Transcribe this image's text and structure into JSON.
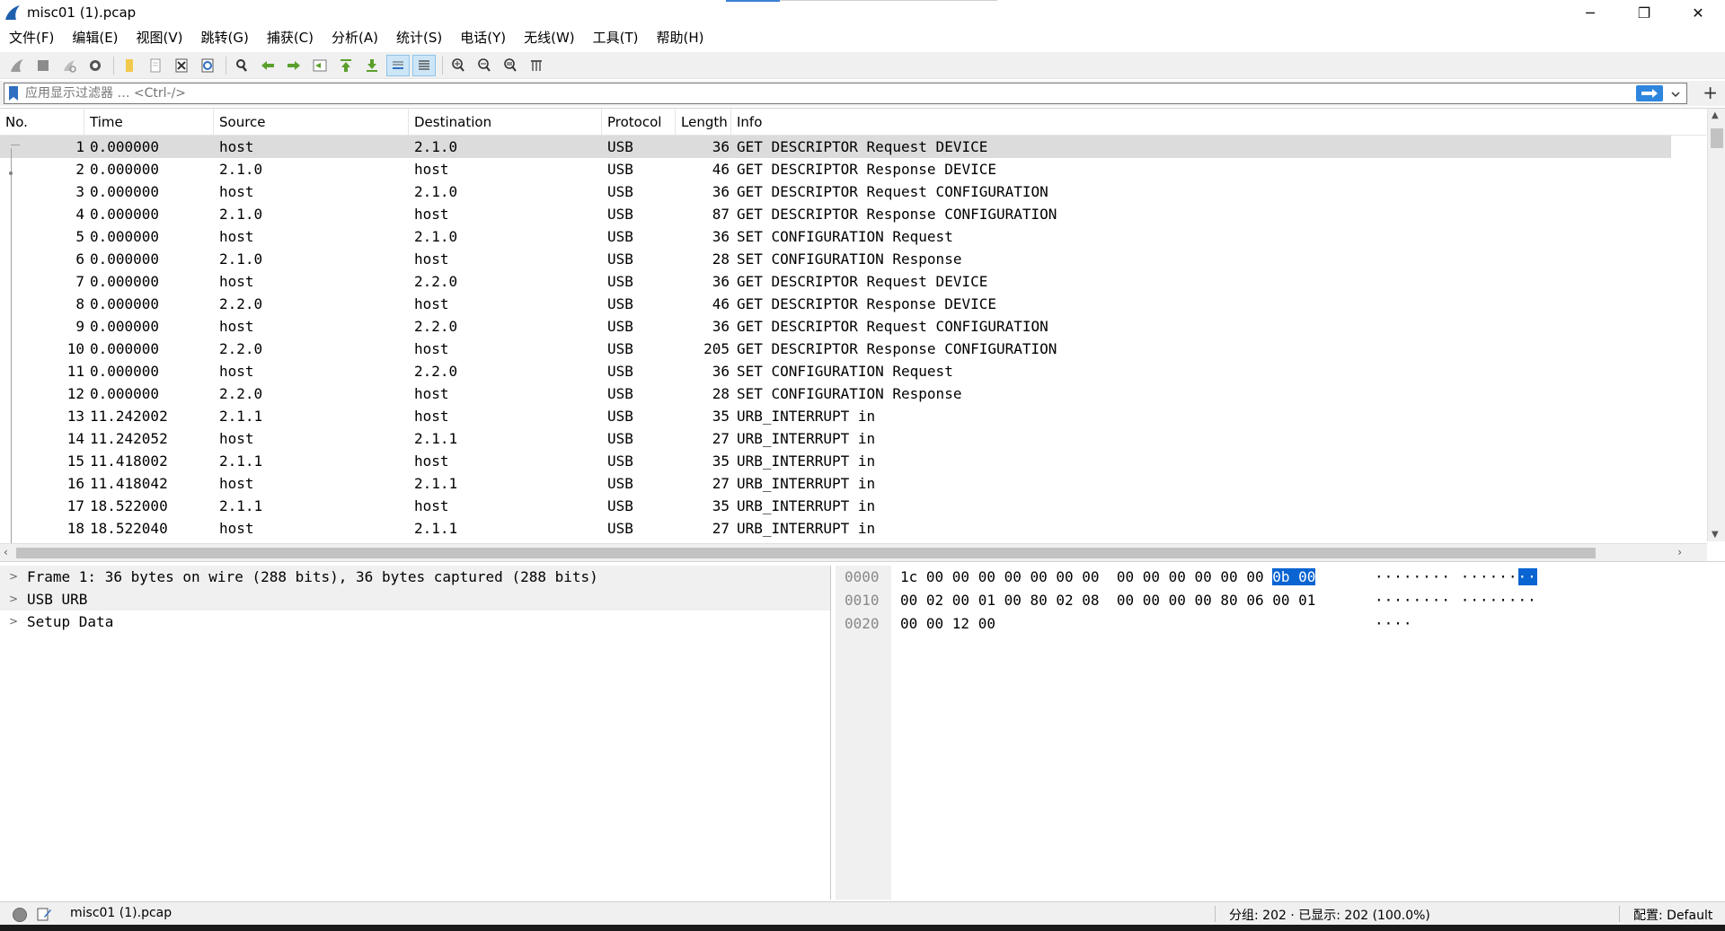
{
  "window": {
    "title": "misc01 (1).pcap",
    "minimize": "─",
    "maximize": "❐",
    "close": "✕"
  },
  "menu": [
    "文件(F)",
    "编辑(E)",
    "视图(V)",
    "跳转(G)",
    "捕获(C)",
    "分析(A)",
    "统计(S)",
    "电话(Y)",
    "无线(W)",
    "工具(T)",
    "帮助(H)"
  ],
  "filter": {
    "placeholder": "应用显示过滤器 … <Ctrl-/>",
    "plus": "+"
  },
  "columns": [
    "No.",
    "Time",
    "Source",
    "Destination",
    "Protocol",
    "Length",
    "Info"
  ],
  "packets": [
    {
      "no": "1",
      "time": "0.000000",
      "src": "host",
      "dst": "2.1.0",
      "proto": "USB",
      "len": "36",
      "info": "GET DESCRIPTOR Request DEVICE"
    },
    {
      "no": "2",
      "time": "0.000000",
      "src": "2.1.0",
      "dst": "host",
      "proto": "USB",
      "len": "46",
      "info": "GET DESCRIPTOR Response DEVICE"
    },
    {
      "no": "3",
      "time": "0.000000",
      "src": "host",
      "dst": "2.1.0",
      "proto": "USB",
      "len": "36",
      "info": "GET DESCRIPTOR Request CONFIGURATION"
    },
    {
      "no": "4",
      "time": "0.000000",
      "src": "2.1.0",
      "dst": "host",
      "proto": "USB",
      "len": "87",
      "info": "GET DESCRIPTOR Response CONFIGURATION"
    },
    {
      "no": "5",
      "time": "0.000000",
      "src": "host",
      "dst": "2.1.0",
      "proto": "USB",
      "len": "36",
      "info": "SET CONFIGURATION Request"
    },
    {
      "no": "6",
      "time": "0.000000",
      "src": "2.1.0",
      "dst": "host",
      "proto": "USB",
      "len": "28",
      "info": "SET CONFIGURATION Response"
    },
    {
      "no": "7",
      "time": "0.000000",
      "src": "host",
      "dst": "2.2.0",
      "proto": "USB",
      "len": "36",
      "info": "GET DESCRIPTOR Request DEVICE"
    },
    {
      "no": "8",
      "time": "0.000000",
      "src": "2.2.0",
      "dst": "host",
      "proto": "USB",
      "len": "46",
      "info": "GET DESCRIPTOR Response DEVICE"
    },
    {
      "no": "9",
      "time": "0.000000",
      "src": "host",
      "dst": "2.2.0",
      "proto": "USB",
      "len": "36",
      "info": "GET DESCRIPTOR Request CONFIGURATION"
    },
    {
      "no": "10",
      "time": "0.000000",
      "src": "2.2.0",
      "dst": "host",
      "proto": "USB",
      "len": "205",
      "info": "GET DESCRIPTOR Response CONFIGURATION"
    },
    {
      "no": "11",
      "time": "0.000000",
      "src": "host",
      "dst": "2.2.0",
      "proto": "USB",
      "len": "36",
      "info": "SET CONFIGURATION Request"
    },
    {
      "no": "12",
      "time": "0.000000",
      "src": "2.2.0",
      "dst": "host",
      "proto": "USB",
      "len": "28",
      "info": "SET CONFIGURATION Response"
    },
    {
      "no": "13",
      "time": "11.242002",
      "src": "2.1.1",
      "dst": "host",
      "proto": "USB",
      "len": "35",
      "info": "URB_INTERRUPT in"
    },
    {
      "no": "14",
      "time": "11.242052",
      "src": "host",
      "dst": "2.1.1",
      "proto": "USB",
      "len": "27",
      "info": "URB_INTERRUPT in"
    },
    {
      "no": "15",
      "time": "11.418002",
      "src": "2.1.1",
      "dst": "host",
      "proto": "USB",
      "len": "35",
      "info": "URB_INTERRUPT in"
    },
    {
      "no": "16",
      "time": "11.418042",
      "src": "host",
      "dst": "2.1.1",
      "proto": "USB",
      "len": "27",
      "info": "URB_INTERRUPT in"
    },
    {
      "no": "17",
      "time": "18.522000",
      "src": "2.1.1",
      "dst": "host",
      "proto": "USB",
      "len": "35",
      "info": "URB_INTERRUPT in"
    },
    {
      "no": "18",
      "time": "18.522040",
      "src": "host",
      "dst": "2.1.1",
      "proto": "USB",
      "len": "27",
      "info": "URB_INTERRUPT in"
    }
  ],
  "details": [
    "Frame 1: 36 bytes on wire (288 bits), 36 bytes captured (288 bits)",
    "USB URB",
    "Setup Data"
  ],
  "bytes": [
    {
      "off": "0000",
      "hex_pre": "1c 00 00 00 00 00 00 00  00 00 00 00 00 00 ",
      "hex_hl": "0b 00",
      "asc_pre": "········ ······",
      "asc_hl": "··"
    },
    {
      "off": "0010",
      "hex_pre": "00 02 00 01 00 80 02 08  00 00 00 00 80 06 00 01",
      "hex_hl": "",
      "asc_pre": "········ ········",
      "asc_hl": ""
    },
    {
      "off": "0020",
      "hex_pre": "00 00 12 00",
      "hex_hl": "",
      "asc_pre": "····",
      "asc_hl": ""
    }
  ],
  "status": {
    "file": "misc01 (1).pcap",
    "counts": "分组: 202 · 已显示: 202 (100.0%)",
    "profile": "配置: Default"
  },
  "colors": {
    "selection": "#dcdcdc",
    "byte_highlight": "#0a64d2",
    "accent": "#2e86de"
  }
}
